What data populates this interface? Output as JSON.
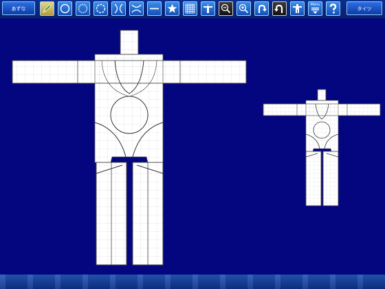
{
  "toolbar": {
    "left_button_label": "あずな",
    "right_button_label": "タイツ",
    "tools": [
      {
        "name": "pencil-tool",
        "icon": "pencil-icon",
        "state": "selected"
      },
      {
        "name": "circle-tool",
        "icon": "circle-icon"
      },
      {
        "name": "circle-dotted-tool",
        "icon": "circle-dotted-icon"
      },
      {
        "name": "circle-dashed-tool",
        "icon": "circle-dashed-icon"
      },
      {
        "name": "curve-in-tool",
        "icon": "curves-in-icon"
      },
      {
        "name": "curve-out-tool",
        "icon": "curves-out-icon"
      },
      {
        "name": "line-tool",
        "icon": "line-icon"
      },
      {
        "name": "star-tool",
        "icon": "star-icon"
      },
      {
        "name": "grid-tool",
        "icon": "grid-icon"
      },
      {
        "name": "hanger-tool",
        "icon": "hanger-icon"
      },
      {
        "name": "zoom-out-tool",
        "icon": "zoom-out-icon",
        "state": "active"
      },
      {
        "name": "zoom-in-tool",
        "icon": "zoom-in-icon"
      },
      {
        "name": "undo-tool",
        "icon": "undo-icon"
      },
      {
        "name": "redo-tool",
        "icon": "redo-icon",
        "state": "active"
      },
      {
        "name": "figure-tool",
        "icon": "figure-icon"
      },
      {
        "name": "menu-tool",
        "icon": "menu-icon",
        "label": "Menu"
      },
      {
        "name": "help-tool",
        "icon": "help-icon"
      }
    ]
  },
  "colors": {
    "background": "#04067f",
    "pattern_fill": "#ffffff",
    "pattern_stroke": "#444444",
    "grid_line": "#c8c8c8"
  }
}
